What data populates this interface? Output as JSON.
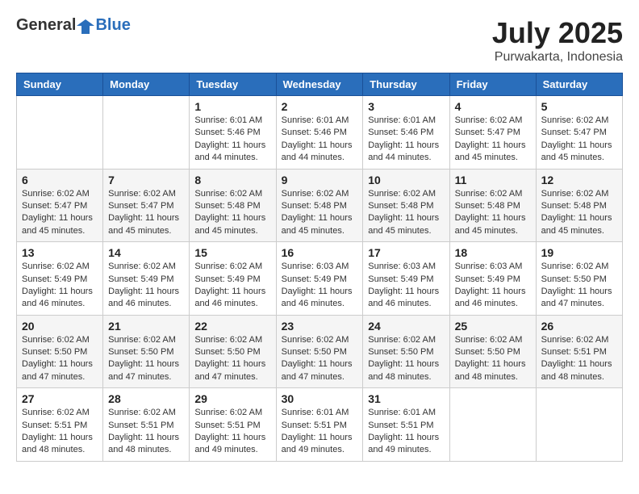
{
  "header": {
    "logo_general": "General",
    "logo_blue": "Blue",
    "month": "July 2025",
    "location": "Purwakarta, Indonesia"
  },
  "weekdays": [
    "Sunday",
    "Monday",
    "Tuesday",
    "Wednesday",
    "Thursday",
    "Friday",
    "Saturday"
  ],
  "weeks": [
    [
      {
        "day": "",
        "info": ""
      },
      {
        "day": "",
        "info": ""
      },
      {
        "day": "1",
        "info": "Sunrise: 6:01 AM\nSunset: 5:46 PM\nDaylight: 11 hours and 44 minutes."
      },
      {
        "day": "2",
        "info": "Sunrise: 6:01 AM\nSunset: 5:46 PM\nDaylight: 11 hours and 44 minutes."
      },
      {
        "day": "3",
        "info": "Sunrise: 6:01 AM\nSunset: 5:46 PM\nDaylight: 11 hours and 44 minutes."
      },
      {
        "day": "4",
        "info": "Sunrise: 6:02 AM\nSunset: 5:47 PM\nDaylight: 11 hours and 45 minutes."
      },
      {
        "day": "5",
        "info": "Sunrise: 6:02 AM\nSunset: 5:47 PM\nDaylight: 11 hours and 45 minutes."
      }
    ],
    [
      {
        "day": "6",
        "info": "Sunrise: 6:02 AM\nSunset: 5:47 PM\nDaylight: 11 hours and 45 minutes."
      },
      {
        "day": "7",
        "info": "Sunrise: 6:02 AM\nSunset: 5:47 PM\nDaylight: 11 hours and 45 minutes."
      },
      {
        "day": "8",
        "info": "Sunrise: 6:02 AM\nSunset: 5:48 PM\nDaylight: 11 hours and 45 minutes."
      },
      {
        "day": "9",
        "info": "Sunrise: 6:02 AM\nSunset: 5:48 PM\nDaylight: 11 hours and 45 minutes."
      },
      {
        "day": "10",
        "info": "Sunrise: 6:02 AM\nSunset: 5:48 PM\nDaylight: 11 hours and 45 minutes."
      },
      {
        "day": "11",
        "info": "Sunrise: 6:02 AM\nSunset: 5:48 PM\nDaylight: 11 hours and 45 minutes."
      },
      {
        "day": "12",
        "info": "Sunrise: 6:02 AM\nSunset: 5:48 PM\nDaylight: 11 hours and 45 minutes."
      }
    ],
    [
      {
        "day": "13",
        "info": "Sunrise: 6:02 AM\nSunset: 5:49 PM\nDaylight: 11 hours and 46 minutes."
      },
      {
        "day": "14",
        "info": "Sunrise: 6:02 AM\nSunset: 5:49 PM\nDaylight: 11 hours and 46 minutes."
      },
      {
        "day": "15",
        "info": "Sunrise: 6:02 AM\nSunset: 5:49 PM\nDaylight: 11 hours and 46 minutes."
      },
      {
        "day": "16",
        "info": "Sunrise: 6:03 AM\nSunset: 5:49 PM\nDaylight: 11 hours and 46 minutes."
      },
      {
        "day": "17",
        "info": "Sunrise: 6:03 AM\nSunset: 5:49 PM\nDaylight: 11 hours and 46 minutes."
      },
      {
        "day": "18",
        "info": "Sunrise: 6:03 AM\nSunset: 5:49 PM\nDaylight: 11 hours and 46 minutes."
      },
      {
        "day": "19",
        "info": "Sunrise: 6:02 AM\nSunset: 5:50 PM\nDaylight: 11 hours and 47 minutes."
      }
    ],
    [
      {
        "day": "20",
        "info": "Sunrise: 6:02 AM\nSunset: 5:50 PM\nDaylight: 11 hours and 47 minutes."
      },
      {
        "day": "21",
        "info": "Sunrise: 6:02 AM\nSunset: 5:50 PM\nDaylight: 11 hours and 47 minutes."
      },
      {
        "day": "22",
        "info": "Sunrise: 6:02 AM\nSunset: 5:50 PM\nDaylight: 11 hours and 47 minutes."
      },
      {
        "day": "23",
        "info": "Sunrise: 6:02 AM\nSunset: 5:50 PM\nDaylight: 11 hours and 47 minutes."
      },
      {
        "day": "24",
        "info": "Sunrise: 6:02 AM\nSunset: 5:50 PM\nDaylight: 11 hours and 48 minutes."
      },
      {
        "day": "25",
        "info": "Sunrise: 6:02 AM\nSunset: 5:50 PM\nDaylight: 11 hours and 48 minutes."
      },
      {
        "day": "26",
        "info": "Sunrise: 6:02 AM\nSunset: 5:51 PM\nDaylight: 11 hours and 48 minutes."
      }
    ],
    [
      {
        "day": "27",
        "info": "Sunrise: 6:02 AM\nSunset: 5:51 PM\nDaylight: 11 hours and 48 minutes."
      },
      {
        "day": "28",
        "info": "Sunrise: 6:02 AM\nSunset: 5:51 PM\nDaylight: 11 hours and 48 minutes."
      },
      {
        "day": "29",
        "info": "Sunrise: 6:02 AM\nSunset: 5:51 PM\nDaylight: 11 hours and 49 minutes."
      },
      {
        "day": "30",
        "info": "Sunrise: 6:01 AM\nSunset: 5:51 PM\nDaylight: 11 hours and 49 minutes."
      },
      {
        "day": "31",
        "info": "Sunrise: 6:01 AM\nSunset: 5:51 PM\nDaylight: 11 hours and 49 minutes."
      },
      {
        "day": "",
        "info": ""
      },
      {
        "day": "",
        "info": ""
      }
    ]
  ]
}
